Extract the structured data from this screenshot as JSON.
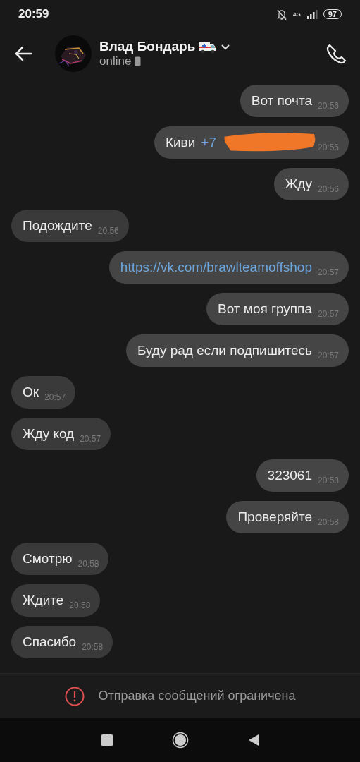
{
  "status_bar": {
    "time": "20:59",
    "network": "4G",
    "battery": "97"
  },
  "header": {
    "name": "Влад Бондарь",
    "status": "online"
  },
  "messages": [
    {
      "kind": "outgoing",
      "text": "Вот почта",
      "time": "20:56"
    },
    {
      "kind": "outgoing",
      "text": "Киви",
      "link": "+7",
      "redacted": true,
      "time": "20:56"
    },
    {
      "kind": "outgoing",
      "text": "Жду",
      "time": "20:56"
    },
    {
      "kind": "incoming",
      "text": "Подождите",
      "time": "20:56"
    },
    {
      "kind": "outgoing",
      "link": "https://vk.com/brawlteamoffshop",
      "time": "20:57"
    },
    {
      "kind": "outgoing",
      "text": "Вот моя группа",
      "time": "20:57"
    },
    {
      "kind": "outgoing",
      "text": "Буду рад если подпишитесь",
      "time": "20:57"
    },
    {
      "kind": "incoming",
      "text": "Ок",
      "time": "20:57"
    },
    {
      "kind": "incoming",
      "text": "Жду код",
      "time": "20:57"
    },
    {
      "kind": "outgoing",
      "text": "323061",
      "time": "20:58"
    },
    {
      "kind": "outgoing",
      "text": "Проверяйте",
      "time": "20:58"
    },
    {
      "kind": "incoming",
      "text": "Смотрю",
      "time": "20:58"
    },
    {
      "kind": "incoming",
      "text": "Ждите",
      "time": "20:58"
    },
    {
      "kind": "incoming",
      "text": "Спасибо",
      "time": "20:58"
    }
  ],
  "notice": "Отправка сообщений ограничена"
}
